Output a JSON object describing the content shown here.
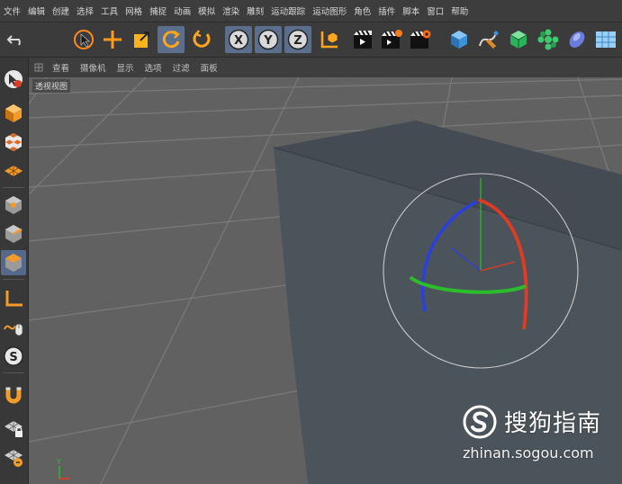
{
  "menu": {
    "items": [
      "文件",
      "编辑",
      "创建",
      "选择",
      "工具",
      "网格",
      "捕捉",
      "动画",
      "模拟",
      "渲染",
      "雕刻",
      "运动跟踪",
      "运动图形",
      "角色",
      "插件",
      "脚本",
      "窗口",
      "帮助"
    ]
  },
  "toolbar": {
    "tools": [
      {
        "name": "undo-icon",
        "active": false
      },
      {
        "name": "live-selection-icon",
        "active": false
      },
      {
        "name": "move-icon",
        "active": false
      },
      {
        "name": "scale-icon",
        "active": false
      },
      {
        "name": "rotate-icon",
        "active": true
      },
      {
        "name": "recent-tool-icon",
        "active": false
      },
      {
        "name": "x-axis-lock-icon",
        "label": "X",
        "active": true
      },
      {
        "name": "y-axis-lock-icon",
        "label": "Y",
        "active": true
      },
      {
        "name": "z-axis-lock-icon",
        "label": "Z",
        "active": true
      },
      {
        "name": "coordinate-system-icon",
        "active": false
      },
      {
        "name": "render-view-icon",
        "active": false
      },
      {
        "name": "render-to-picture-viewer-icon",
        "active": false
      },
      {
        "name": "render-settings-icon",
        "active": false
      },
      {
        "name": "cube-icon",
        "active": false
      },
      {
        "name": "spline-pen-icon",
        "active": false
      },
      {
        "name": "subdivision-surface-icon",
        "active": false
      },
      {
        "name": "cloner-icon",
        "active": false
      },
      {
        "name": "deformer-icon",
        "active": false
      },
      {
        "name": "floor-icon",
        "active": false
      }
    ]
  },
  "palette": {
    "tools": [
      {
        "name": "model-mode-icon"
      },
      {
        "name": "object-mode-icon"
      },
      {
        "name": "texture-mode-icon"
      },
      {
        "name": "workplane-mode-icon"
      },
      {
        "name": "point-mode-icon"
      },
      {
        "name": "edge-mode-icon"
      },
      {
        "name": "polygon-mode-icon"
      },
      {
        "name": "axis-mode-icon"
      },
      {
        "name": "tweak-mode-icon"
      },
      {
        "name": "snap-icon"
      },
      {
        "name": "magnet-icon"
      },
      {
        "name": "workplane-lock-icon"
      },
      {
        "name": "planar-workplane-icon"
      }
    ]
  },
  "viewport": {
    "menu": [
      "查看",
      "摄像机",
      "显示",
      "选项",
      "过滤",
      "面板"
    ],
    "label": "透视视图",
    "colors": {
      "background": "#616161",
      "grid": "#7a7a7a",
      "box": "#4a5157",
      "x_axis": "#e23a23",
      "y_axis": "#2bbd2b",
      "z_axis": "#2a3fe0"
    }
  },
  "watermark": {
    "brand": "搜狗指南",
    "url": "zhinan.sogou.com"
  }
}
